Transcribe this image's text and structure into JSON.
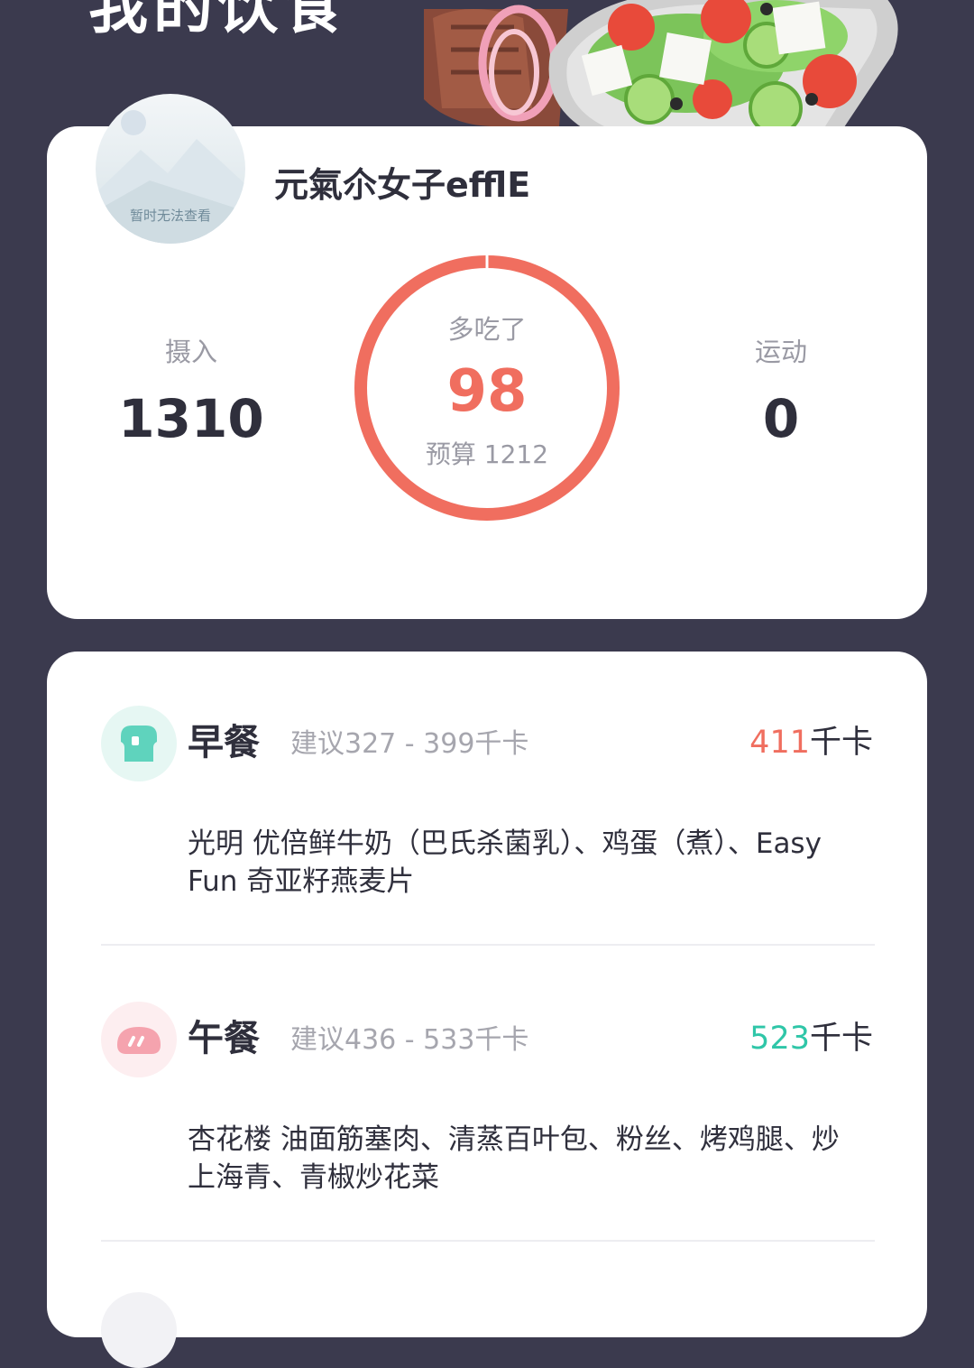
{
  "header": {
    "title": "我的饮食"
  },
  "profile": {
    "avatar_caption": "暂时无法查看",
    "username": "元氣尒女子efflE"
  },
  "summary": {
    "intake_label": "摄入",
    "intake_value": "1310",
    "ring_label": "多吃了",
    "ring_value": "98",
    "budget_label": "预算 1212",
    "exercise_label": "运动",
    "exercise_value": "0"
  },
  "meals": [
    {
      "icon": "toast-icon",
      "name": "早餐",
      "suggestion": "建议327 - 399千卡",
      "kcal": "411",
      "kcal_unit": "千卡",
      "kcal_color": "#f06e5f",
      "foods": "光明 优倍鲜牛奶（巴氏杀菌乳）、鸡蛋（煮）、Easy Fun 奇亚籽燕麦片"
    },
    {
      "icon": "bun-icon",
      "name": "午餐",
      "suggestion": "建议436 - 533千卡",
      "kcal": "523",
      "kcal_unit": "千卡",
      "kcal_color": "#2fc6a8",
      "foods": "杏花楼 油面筋塞肉、清蒸百叶包、粉丝、烤鸡腿、炒上海青、青椒炒花菜"
    }
  ],
  "colors": {
    "background": "#3b3a4e",
    "accent_red": "#f06e5f",
    "accent_teal": "#2fc6a8"
  }
}
